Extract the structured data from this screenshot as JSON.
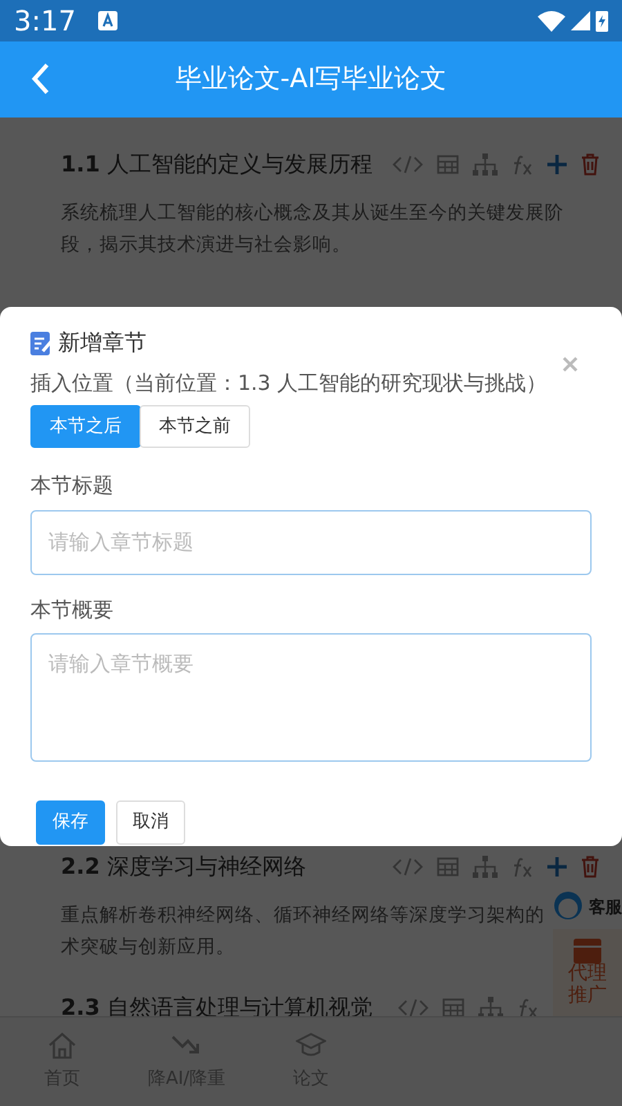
{
  "status_bar": {
    "time": "3:17"
  },
  "header": {
    "title": "毕业论文-AI写毕业论文"
  },
  "sections": [
    {
      "number": "1.1",
      "title": "人工智能的定义与发展历程",
      "kind": "full",
      "lines": [
        "系统梳理人工智能的核心概念及其从诞生至今的关键发展阶段，揭示其技术演进与社会影响。"
      ]
    },
    {
      "number": "2.2",
      "title": "深度学习与神经网络",
      "kind": "full",
      "lines": [
        "重点解析卷积神经网络、循环神经网络等深度学习架构的",
        "术突破与创新应用。"
      ]
    },
    {
      "number": "2.3",
      "title": "自然语言处理与计算机视觉",
      "kind": "covered"
    }
  ],
  "side_buttons": [
    {
      "kind": "service",
      "label": "客服"
    },
    {
      "kind": "promo",
      "label": "代理推广"
    }
  ],
  "bottom_nav": [
    {
      "kind": "home",
      "label": "首页"
    },
    {
      "kind": "trend",
      "label": "降AI/降重"
    },
    {
      "kind": "cap",
      "label": "论文"
    }
  ],
  "dialog": {
    "title": "新增章节",
    "position_label": "插入位置（当前位置：1.3 人工智能的研究现状与挑战）",
    "position_options": [
      {
        "label": "本节之后",
        "selected": true
      },
      {
        "label": "本节之前",
        "selected": false
      }
    ],
    "fields": [
      {
        "kind": "input",
        "label": "本节标题",
        "placeholder": "请输入章节标题"
      },
      {
        "kind": "textarea",
        "label": "本节概要",
        "placeholder": "请输入章节概要"
      }
    ],
    "buttons": [
      {
        "kind": "primary",
        "label": "保存"
      },
      {
        "kind": "secondary",
        "label": "取消"
      }
    ]
  }
}
